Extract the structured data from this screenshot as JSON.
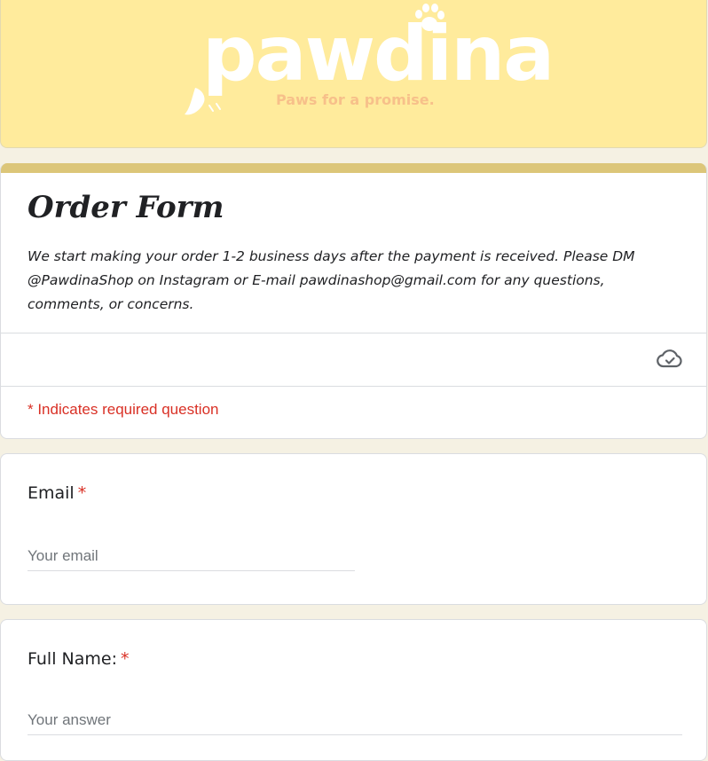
{
  "banner": {
    "logo_text": "pawdina",
    "tagline": "Paws for a promise."
  },
  "form": {
    "title": "Order Form",
    "description": "We start making your order 1-2 business days after the payment is received. Please DM @PawdinaShop on Instagram or E-mail pawdinashop@gmail.com for any questions, comments, or concerns.",
    "required_note": "* Indicates required question",
    "save_status_icon": "cloud-check-icon"
  },
  "questions": [
    {
      "label": "Email",
      "required_marker": "*",
      "placeholder": "Your email",
      "value": ""
    },
    {
      "label": "Full Name:",
      "required_marker": "*",
      "placeholder": "Your answer",
      "value": ""
    }
  ],
  "colors": {
    "banner_bg": "#ffeb9c",
    "header_band": "#dcc679",
    "page_bg": "#f5f1e3",
    "required_red": "#d93025"
  }
}
